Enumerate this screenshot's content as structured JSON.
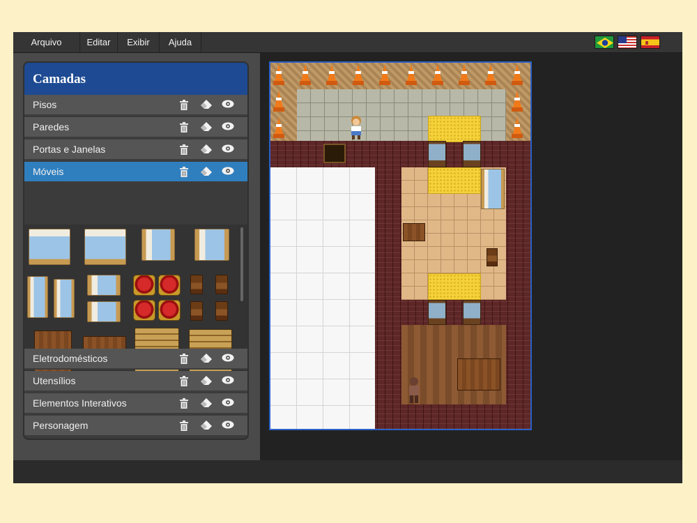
{
  "menu": {
    "items": [
      {
        "label": "Arquivo"
      },
      {
        "label": "Editar"
      },
      {
        "label": "Exibir"
      },
      {
        "label": "Ajuda"
      }
    ]
  },
  "languages": [
    {
      "name": "brazil-flag-icon"
    },
    {
      "name": "usa-flag-icon"
    },
    {
      "name": "spain-flag-icon"
    }
  ],
  "layers_panel": {
    "title": "Camadas",
    "layers": [
      {
        "label": "Pisos",
        "active": false
      },
      {
        "label": "Paredes",
        "active": false
      },
      {
        "label": "Portas e Janelas",
        "active": false
      },
      {
        "label": "Móveis",
        "active": true
      },
      {
        "label": "Eletrodomésticos",
        "active": false
      },
      {
        "label": "Utensílios",
        "active": false
      },
      {
        "label": "Elementos Interativos",
        "active": false
      },
      {
        "label": "Personagem",
        "active": false
      }
    ],
    "layer_tools": [
      "trash-icon",
      "eraser-icon",
      "eye-icon"
    ]
  },
  "colors": {
    "header_blue": "#1d4a92",
    "active_layer": "#2f7fbf",
    "map_border": "#2a60c8",
    "page_background": "#fdf1c8"
  }
}
